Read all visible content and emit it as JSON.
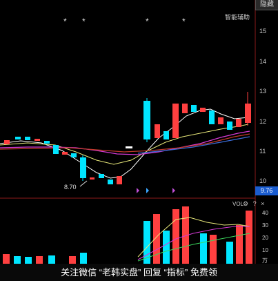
{
  "toolbar": {
    "hide_label": "隐藏",
    "assist_label": "智能辅助"
  },
  "price_axis": {
    "ticks": [
      "15",
      "14",
      "13",
      "12",
      "11",
      "10"
    ]
  },
  "volume_axis": {
    "ticks": [
      "40",
      "30",
      "20",
      "10",
      "万"
    ]
  },
  "last_price": "9.76",
  "low_marker": "8.70",
  "volume_panel": {
    "title": "VOL",
    "icons": "⚙ ? ×"
  },
  "markers": [
    "*",
    "*",
    "*",
    "*"
  ],
  "watermark_text": "关注微信 “老韩实盘” 回复 “指标” 免费领",
  "colors": {
    "up": "#ff4040",
    "down": "#00e5ff",
    "ma_white": "#ffffff",
    "ma_yellow": "#e8e87a",
    "ma_purple": "#d63ad6",
    "ma_red": "#c0392b",
    "ma_blue": "#3a6bd6"
  }
}
